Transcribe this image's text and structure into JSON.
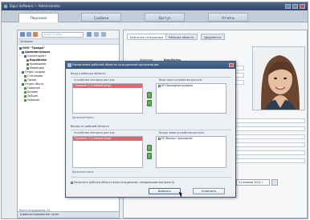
{
  "window": {
    "title": "Sigur Software — Administrator",
    "icons": {
      "app": "app-icon",
      "minimize": "minimize-icon",
      "maximize": "maximize-icon",
      "close": "close-icon"
    }
  },
  "main_tabs": [
    {
      "label": "Персонал",
      "active": true
    },
    {
      "label": "Графики",
      "active": false
    },
    {
      "label": "Доступ",
      "active": false
    },
    {
      "label": "Отчеты",
      "active": false
    }
  ],
  "left_panel": {
    "search_placeholder": "Поиск по базе",
    "header": "Название",
    "tree": [
      {
        "label": "ООО \"Триада\"",
        "level": 0
      },
      {
        "label": "Администрация",
        "level": 1
      },
      {
        "label": "Секретариат",
        "level": 2
      },
      {
        "label": "Воробьёва",
        "level": 3
      },
      {
        "label": "Кривошеев",
        "level": 3
      },
      {
        "label": "Медведев",
        "level": 3
      },
      {
        "label": "Отдел кадров",
        "level": 1
      },
      {
        "label": "Степанова",
        "level": 2
      },
      {
        "label": "Орлов",
        "level": 2
      },
      {
        "label": "Отдел сбыта",
        "level": 1
      },
      {
        "label": "Смирнов",
        "level": 2
      },
      {
        "label": "Белова",
        "level": 2
      },
      {
        "label": "Зайцев",
        "level": 2
      },
      {
        "label": "Новиков",
        "level": 2
      }
    ],
    "status_text": "Всего сотрудников: 14",
    "bottom_tab": "Администрирование групп"
  },
  "right_panel": {
    "tabs": [
      {
        "label": "Карточка сотрудника",
        "active": true
      },
      {
        "label": "Рабочая область",
        "active": false
      },
      {
        "label": "Документы",
        "active": false
      }
    ],
    "name_label": "Фамилия",
    "name_value": "Воробьёва",
    "date_value": "21 апреля 2011 г."
  },
  "dialog": {
    "title": "Назначение рабочей области сотрудникам организации",
    "entry_section": "Вход в рабочую область",
    "exit_section": "Выход из рабочей области",
    "entry_left_header": "Устройства контроля доступа",
    "entry_right_header": "Вход через устройства доступа",
    "exit_left_header": "Устройства контроля доступа",
    "exit_right_header": "Выход через устройства доступа",
    "entry_left_items": [
      "Турникет 1 (главный вход)"
    ],
    "entry_right_items": [
      "КП Проходная входная"
    ],
    "exit_left_items": [
      "Турникет 2 (главный вход)"
    ],
    "exit_right_items": [
      "КП Выход с проходной"
    ],
    "entry_link": "Дополнительно",
    "exit_link": "Дополнительно",
    "bottom_checkbox": "Назначить рабочую область всем сотрудникам, попадающим под фильтр",
    "ok_label": "Выбрать",
    "cancel_label": "Отменить"
  }
}
